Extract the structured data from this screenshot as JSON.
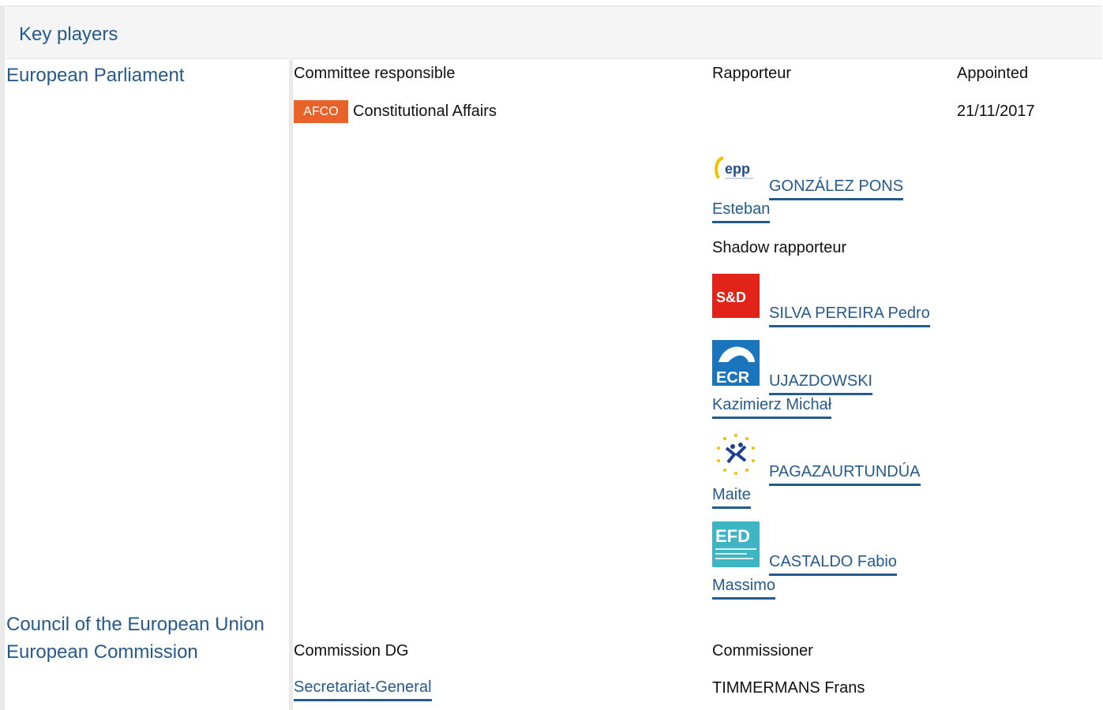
{
  "section": {
    "title": "Key players"
  },
  "institutions": {
    "ep": "European Parliament",
    "council": "Council of the European Union",
    "commission": "European Commission"
  },
  "ep": {
    "col_committee": "Committee responsible",
    "col_rapporteur": "Rapporteur",
    "col_appointed": "Appointed",
    "committee_code": "AFCO",
    "committee_name": "Constitutional Affairs",
    "appointed_date": "21/11/2017",
    "shadow_label": "Shadow rapporteur",
    "rapporteur": {
      "name_line1": "GONZÁLEZ PONS",
      "name_line2": "Esteban",
      "group_logo": "epp-logo",
      "group_text": "epp"
    },
    "shadows": [
      {
        "name_line1": "SILVA PEREIRA Pedro",
        "name_line2": "",
        "group_logo": "sd-logo",
        "group_text": "S&D"
      },
      {
        "name_line1": "UJAZDOWSKI",
        "name_line2": "Kazimierz Michał",
        "group_logo": "ecr-logo",
        "group_text": "ECR"
      },
      {
        "name_line1": "PAGAZAURTUNDÚA",
        "name_line2": "Maite",
        "group_logo": "alde-logo",
        "group_text": ""
      },
      {
        "name_line1": "CASTALDO Fabio",
        "name_line2": "Massimo",
        "group_logo": "efdd-logo",
        "group_text": "EFD"
      }
    ]
  },
  "commission": {
    "col_dg": "Commission DG",
    "col_commissioner": "Commissioner",
    "dg": "Secretariat-General",
    "commissioner": "TIMMERMANS Frans"
  },
  "colors": {
    "link": "#245a8d",
    "afco_badge": "#e8622a",
    "sd_red": "#e2231a",
    "ecr_blue": "#1b75bc",
    "efdd_teal": "#3fb5c4"
  }
}
